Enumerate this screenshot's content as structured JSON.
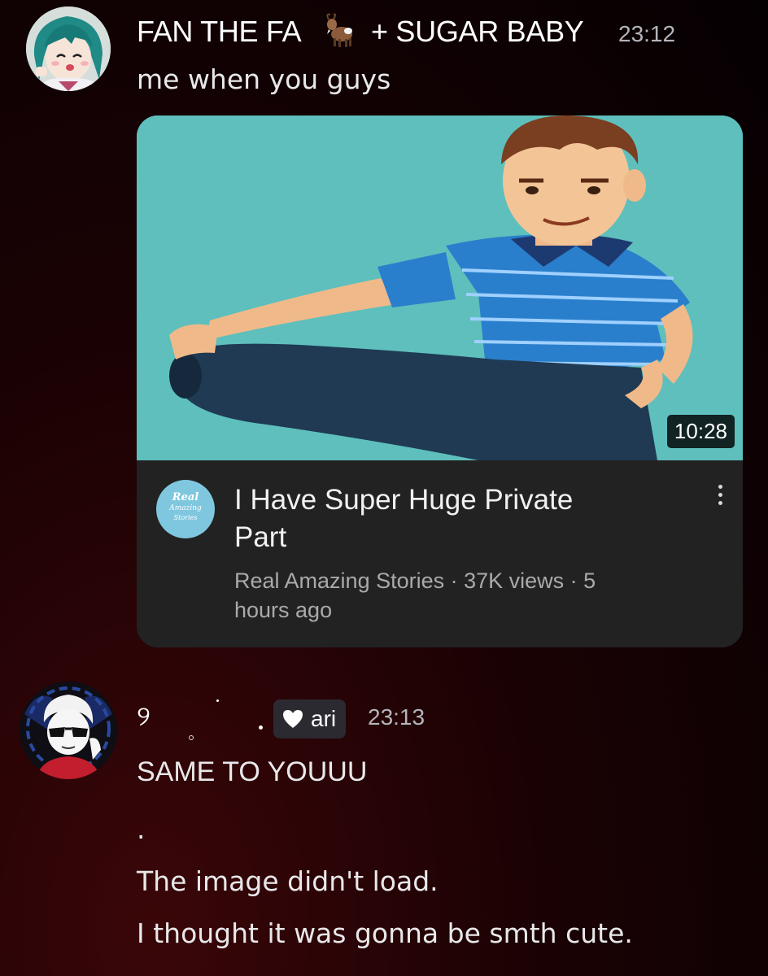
{
  "messages": [
    {
      "username": "FAN THE FA",
      "username_suffix": "+ SUGAR BABY",
      "username_emoji": "goat-emoji",
      "timestamp": "23:12",
      "text": "me when you guys",
      "embed": {
        "duration": "10:28",
        "channel_avatar_text": [
          "Real",
          "Amazing",
          "Stories"
        ],
        "title_lines": [
          "I Have Super Huge Private",
          "Part"
        ],
        "meta_lines": [
          "Real Amazing Stories · 37K views · 5",
          "hours ago"
        ]
      }
    },
    {
      "username": "୨",
      "role_badge": {
        "icon": "heart-icon",
        "label": "ari"
      },
      "timestamp": "23:13",
      "text": "SAME TO YOUUU",
      "lines": [
        ".",
        "The image didn't load.",
        "I thought it was gonna be smth cute."
      ]
    }
  ],
  "colors": {
    "background": "#0a0103",
    "timestamp": "#b5b5bb",
    "embed_bg": "#222222",
    "thumbnail_bg": "#5ebfbd",
    "meta_text": "#aaaaaa"
  }
}
